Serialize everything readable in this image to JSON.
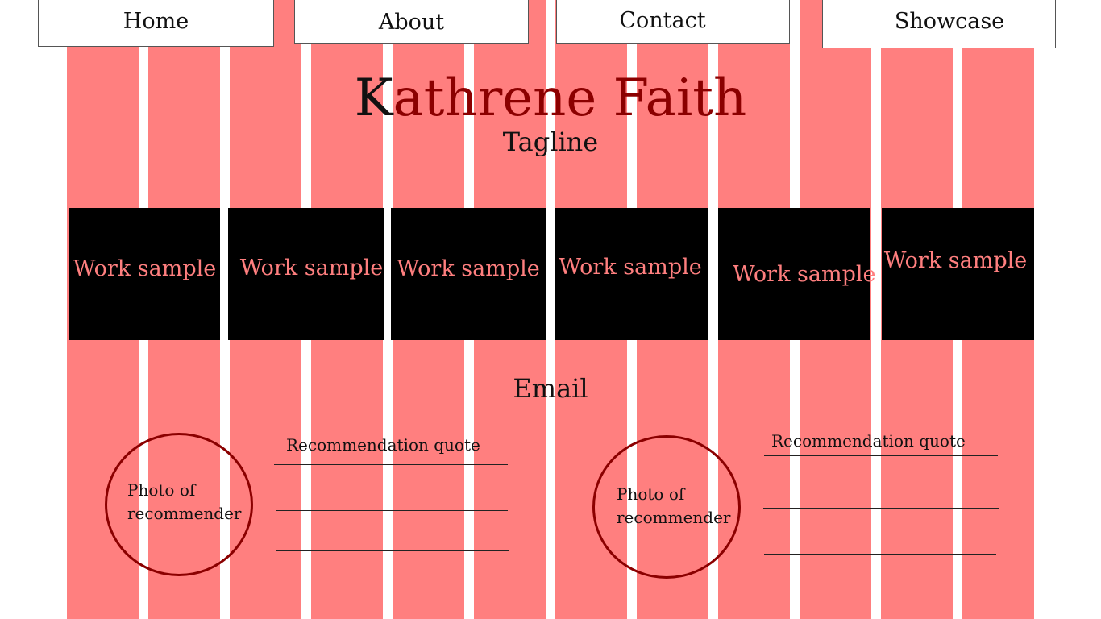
{
  "colors": {
    "column": "#ff7f7f",
    "work_sample_bg": "#000000",
    "work_sample_text": "#ff7f7f",
    "title": "#8b0000",
    "circle": "#8b0000"
  },
  "nav": {
    "items": [
      {
        "label": "Home"
      },
      {
        "label": "About"
      },
      {
        "label": "Contact"
      },
      {
        "label": "Showcase"
      }
    ]
  },
  "header": {
    "title_first": "K",
    "title_rest": "athrene Faith",
    "tagline": "Tagline"
  },
  "work_samples": [
    {
      "label": "Work sample"
    },
    {
      "label": "Work sample"
    },
    {
      "label": "Work sample"
    },
    {
      "label": "Work sample"
    },
    {
      "label": "Work sample"
    },
    {
      "label": "Work sample"
    }
  ],
  "contact": {
    "email_label": "Email"
  },
  "recommendations": [
    {
      "photo_label": "Photo of\nrecommender",
      "quote_label": "Recommendation quote"
    },
    {
      "photo_label": "Photo of\nrecommender",
      "quote_label": "Recommendation quote"
    }
  ]
}
